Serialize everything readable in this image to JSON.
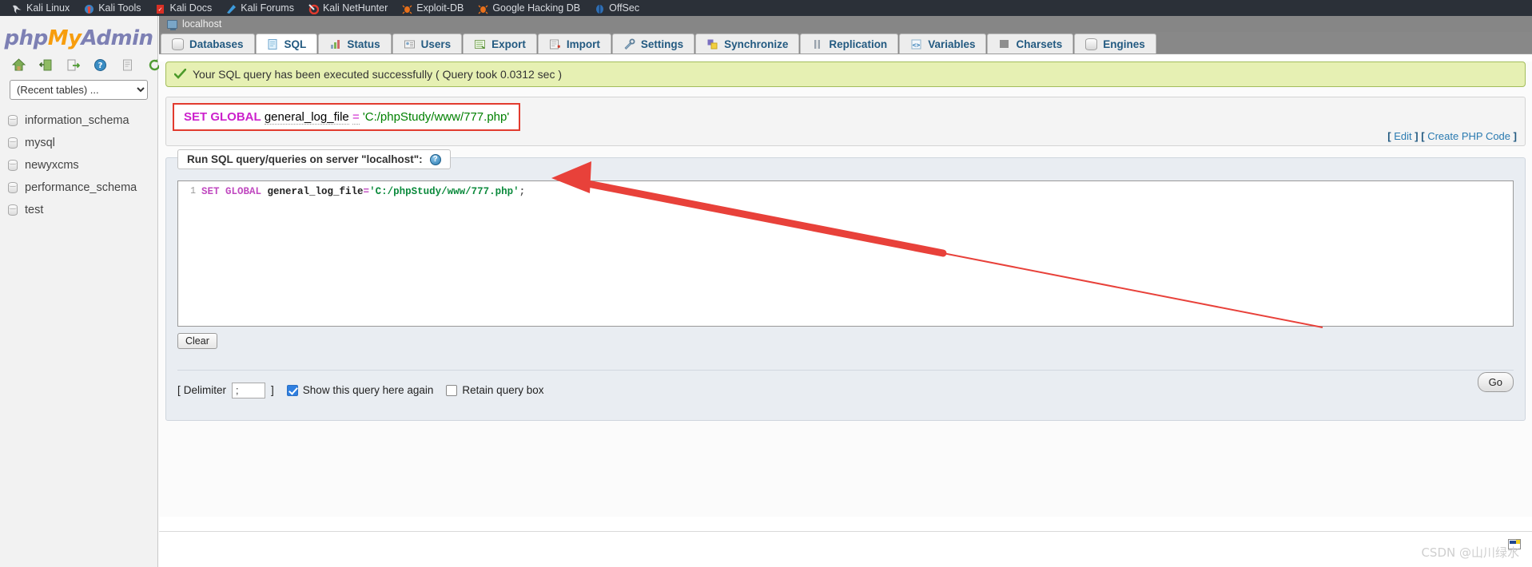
{
  "browser": {
    "bookmarks": [
      {
        "label": "Kali Linux",
        "icon": "kali-dragon-icon"
      },
      {
        "label": "Kali Tools",
        "icon": "kali-tools-icon"
      },
      {
        "label": "Kali Docs",
        "icon": "kali-docs-icon"
      },
      {
        "label": "Kali Forums",
        "icon": "kali-forums-icon"
      },
      {
        "label": "Kali NetHunter",
        "icon": "kali-nethunter-icon"
      },
      {
        "label": "Exploit-DB",
        "icon": "exploit-db-icon"
      },
      {
        "label": "Google Hacking DB",
        "icon": "google-hacking-db-icon"
      },
      {
        "label": "OffSec",
        "icon": "offsec-icon"
      }
    ]
  },
  "sidebar": {
    "logo": {
      "part1": "php",
      "part2": "My",
      "part3": "Admin"
    },
    "icons": [
      {
        "name": "home-icon",
        "title": "Home"
      },
      {
        "name": "logout-icon",
        "title": "Log out"
      },
      {
        "name": "sql-export-icon",
        "title": "Query window"
      },
      {
        "name": "help-icon",
        "title": "phpMyAdmin documentation"
      },
      {
        "name": "docs-icon",
        "title": "Documentation"
      },
      {
        "name": "reload-icon",
        "title": "Reload navigation panel"
      }
    ],
    "recent_tables_value": "(Recent tables) ...",
    "databases": [
      "information_schema",
      "mysql",
      "newyxcms",
      "performance_schema",
      "test"
    ]
  },
  "server_bar": {
    "label": "localhost",
    "icon": "server-monitor-icon"
  },
  "tabs": [
    {
      "label": "Databases",
      "icon": "databases-icon",
      "active": false
    },
    {
      "label": "SQL",
      "icon": "sql-icon",
      "active": true
    },
    {
      "label": "Status",
      "icon": "status-icon",
      "active": false
    },
    {
      "label": "Users",
      "icon": "users-icon",
      "active": false
    },
    {
      "label": "Export",
      "icon": "export-icon",
      "active": false
    },
    {
      "label": "Import",
      "icon": "import-icon",
      "active": false
    },
    {
      "label": "Settings",
      "icon": "settings-icon",
      "active": false
    },
    {
      "label": "Synchronize",
      "icon": "synchronize-icon",
      "active": false
    },
    {
      "label": "Replication",
      "icon": "replication-icon",
      "active": false
    },
    {
      "label": "Variables",
      "icon": "variables-icon",
      "active": false
    },
    {
      "label": "Charsets",
      "icon": "charsets-icon",
      "active": false
    },
    {
      "label": "Engines",
      "icon": "engines-icon",
      "active": false
    }
  ],
  "success": {
    "message": "Your SQL query has been executed successfully ( Query took 0.0312 sec )",
    "icon": "green-check-icon",
    "background": "#e6f0b3",
    "border": "#a3bd5c"
  },
  "sql_echo": {
    "keyword": "SET GLOBAL",
    "identifier": "general_log_file",
    "operator": "=",
    "string": "'C:/phpStudy/www/777.php'",
    "highlight_border": "#e23b2e",
    "keyword_color": "#cc22cc",
    "string_color": "#008000"
  },
  "echo_links": {
    "edit": "Edit",
    "create_php_code": "Create PHP Code"
  },
  "query_panel": {
    "legend": "Run SQL query/queries on server \"localhost\":",
    "help_icon": "help-icon",
    "editor": {
      "line_number": "1",
      "keyword": "SET GLOBAL",
      "identifier": " general_log_file",
      "operator": "=",
      "string": "'C:/phpStudy/www/777.php'",
      "terminator": ";"
    },
    "clear_button": "Clear"
  },
  "query_footer": {
    "bracket_open": "[",
    "delimiter_label": "Delimiter",
    "delimiter_value": ";",
    "bracket_close": "]",
    "show_query_label": "Show this query here again",
    "show_query_checked": true,
    "retain_box_label": "Retain query box",
    "retain_box_checked": false,
    "go_button": "Go"
  },
  "console": {
    "toggle_icon": "console-toggle-icon"
  },
  "watermark": "CSDN @山川绿水"
}
